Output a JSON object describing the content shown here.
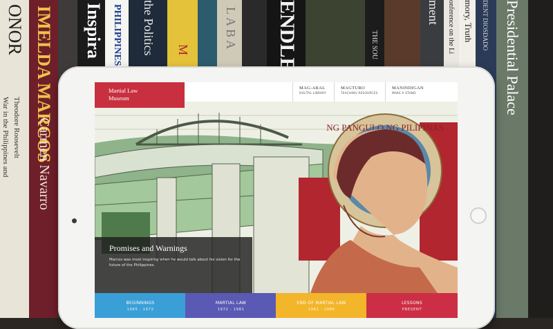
{
  "bookshelf": {
    "spines": [
      "ONOR",
      "IMELDA MARCOS",
      "Carmen Navarro",
      "War in the Philippines and",
      "Theodore Roosevelt",
      "Inspira",
      "PHILIPPINES",
      "the Politics",
      "M",
      "LABA",
      "ENDLES",
      "THE SOU",
      "ment",
      "onference on the Li",
      "mory, Truth",
      "DENT DIOSDADO",
      "Presidential Palace"
    ]
  },
  "site": {
    "logo": "Martial Law Museum",
    "nav": [
      {
        "label": "MAG-ARAL",
        "sub": "DIGITAL LIBRARY"
      },
      {
        "label": "MAGTURO",
        "sub": "TEACHING RESOURCES"
      },
      {
        "label": "MANINDIGAN",
        "sub": "MAKE A STAND"
      }
    ],
    "seal_text": "NG PANGULO NG PILIPINAS",
    "hero": {
      "title": "Promises and Warnings",
      "text": "Marcos was most inspiring when he would talk about his vision for the future of the Philippines."
    },
    "tabs": [
      {
        "label": "BEGINNINGS",
        "years": "1965 - 1972",
        "color": "#3a9fd6"
      },
      {
        "label": "MARTIAL LAW",
        "years": "1972 - 1981",
        "color": "#5a5ab4"
      },
      {
        "label": "END OF MARTIAL LAW",
        "years": "1981 - 1986",
        "color": "#f3b52a"
      },
      {
        "label": "LESSONS",
        "years": "PRESENT",
        "color": "#cc2f45"
      }
    ]
  }
}
